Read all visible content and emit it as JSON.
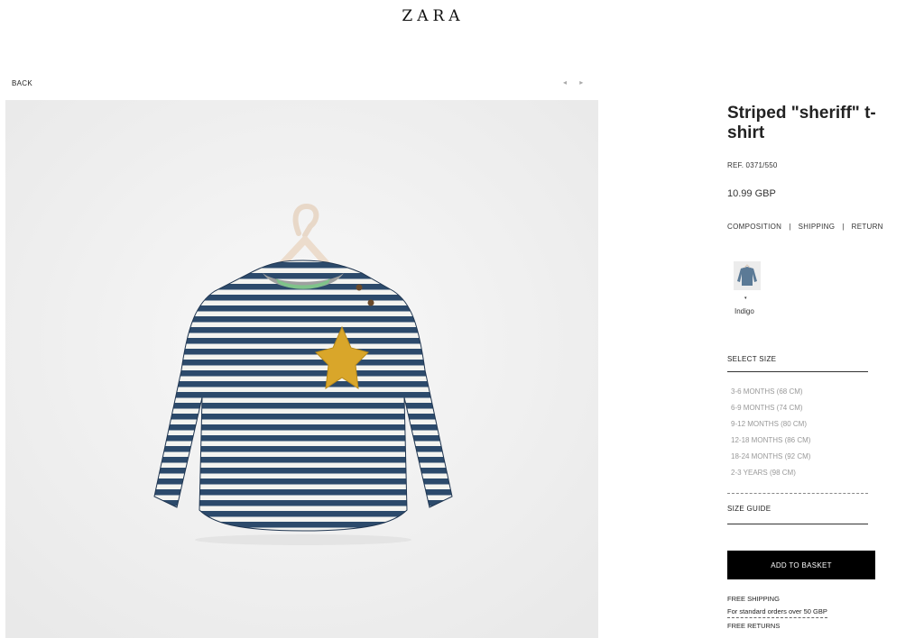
{
  "brand": {
    "logo": "ZARA"
  },
  "nav": {
    "back_label": "BACK",
    "prev_icon": "◂",
    "next_icon": "▸"
  },
  "product": {
    "title": "Striped \"sheriff\" t-shirt",
    "ref": "REF. 0371/550",
    "price": "10.99 GBP",
    "links": [
      "COMPOSITION",
      "SHIPPING",
      "RETURN"
    ],
    "separator": "|",
    "color": {
      "marker": "▾",
      "name": "Indigo"
    }
  },
  "sizes": {
    "heading": "SELECT SIZE",
    "options": [
      "3-6 MONTHS (68 CM)",
      "6-9 MONTHS (74 CM)",
      "9-12 MONTHS (80 CM)",
      "12-18 MONTHS (86 CM)",
      "18-24 MONTHS (92 CM)",
      "2-3 YEARS (98 CM)"
    ],
    "guide": "SIZE GUIDE"
  },
  "basket": {
    "button_label": "ADD TO BASKET"
  },
  "shipping": {
    "line1": "FREE SHIPPING",
    "line2": "For standard orders over 50 GBP",
    "line3": "FREE RETURNS"
  },
  "colors": {
    "stripe": "#2c4a6b",
    "star": "#d9a62a",
    "button": "#000000"
  }
}
